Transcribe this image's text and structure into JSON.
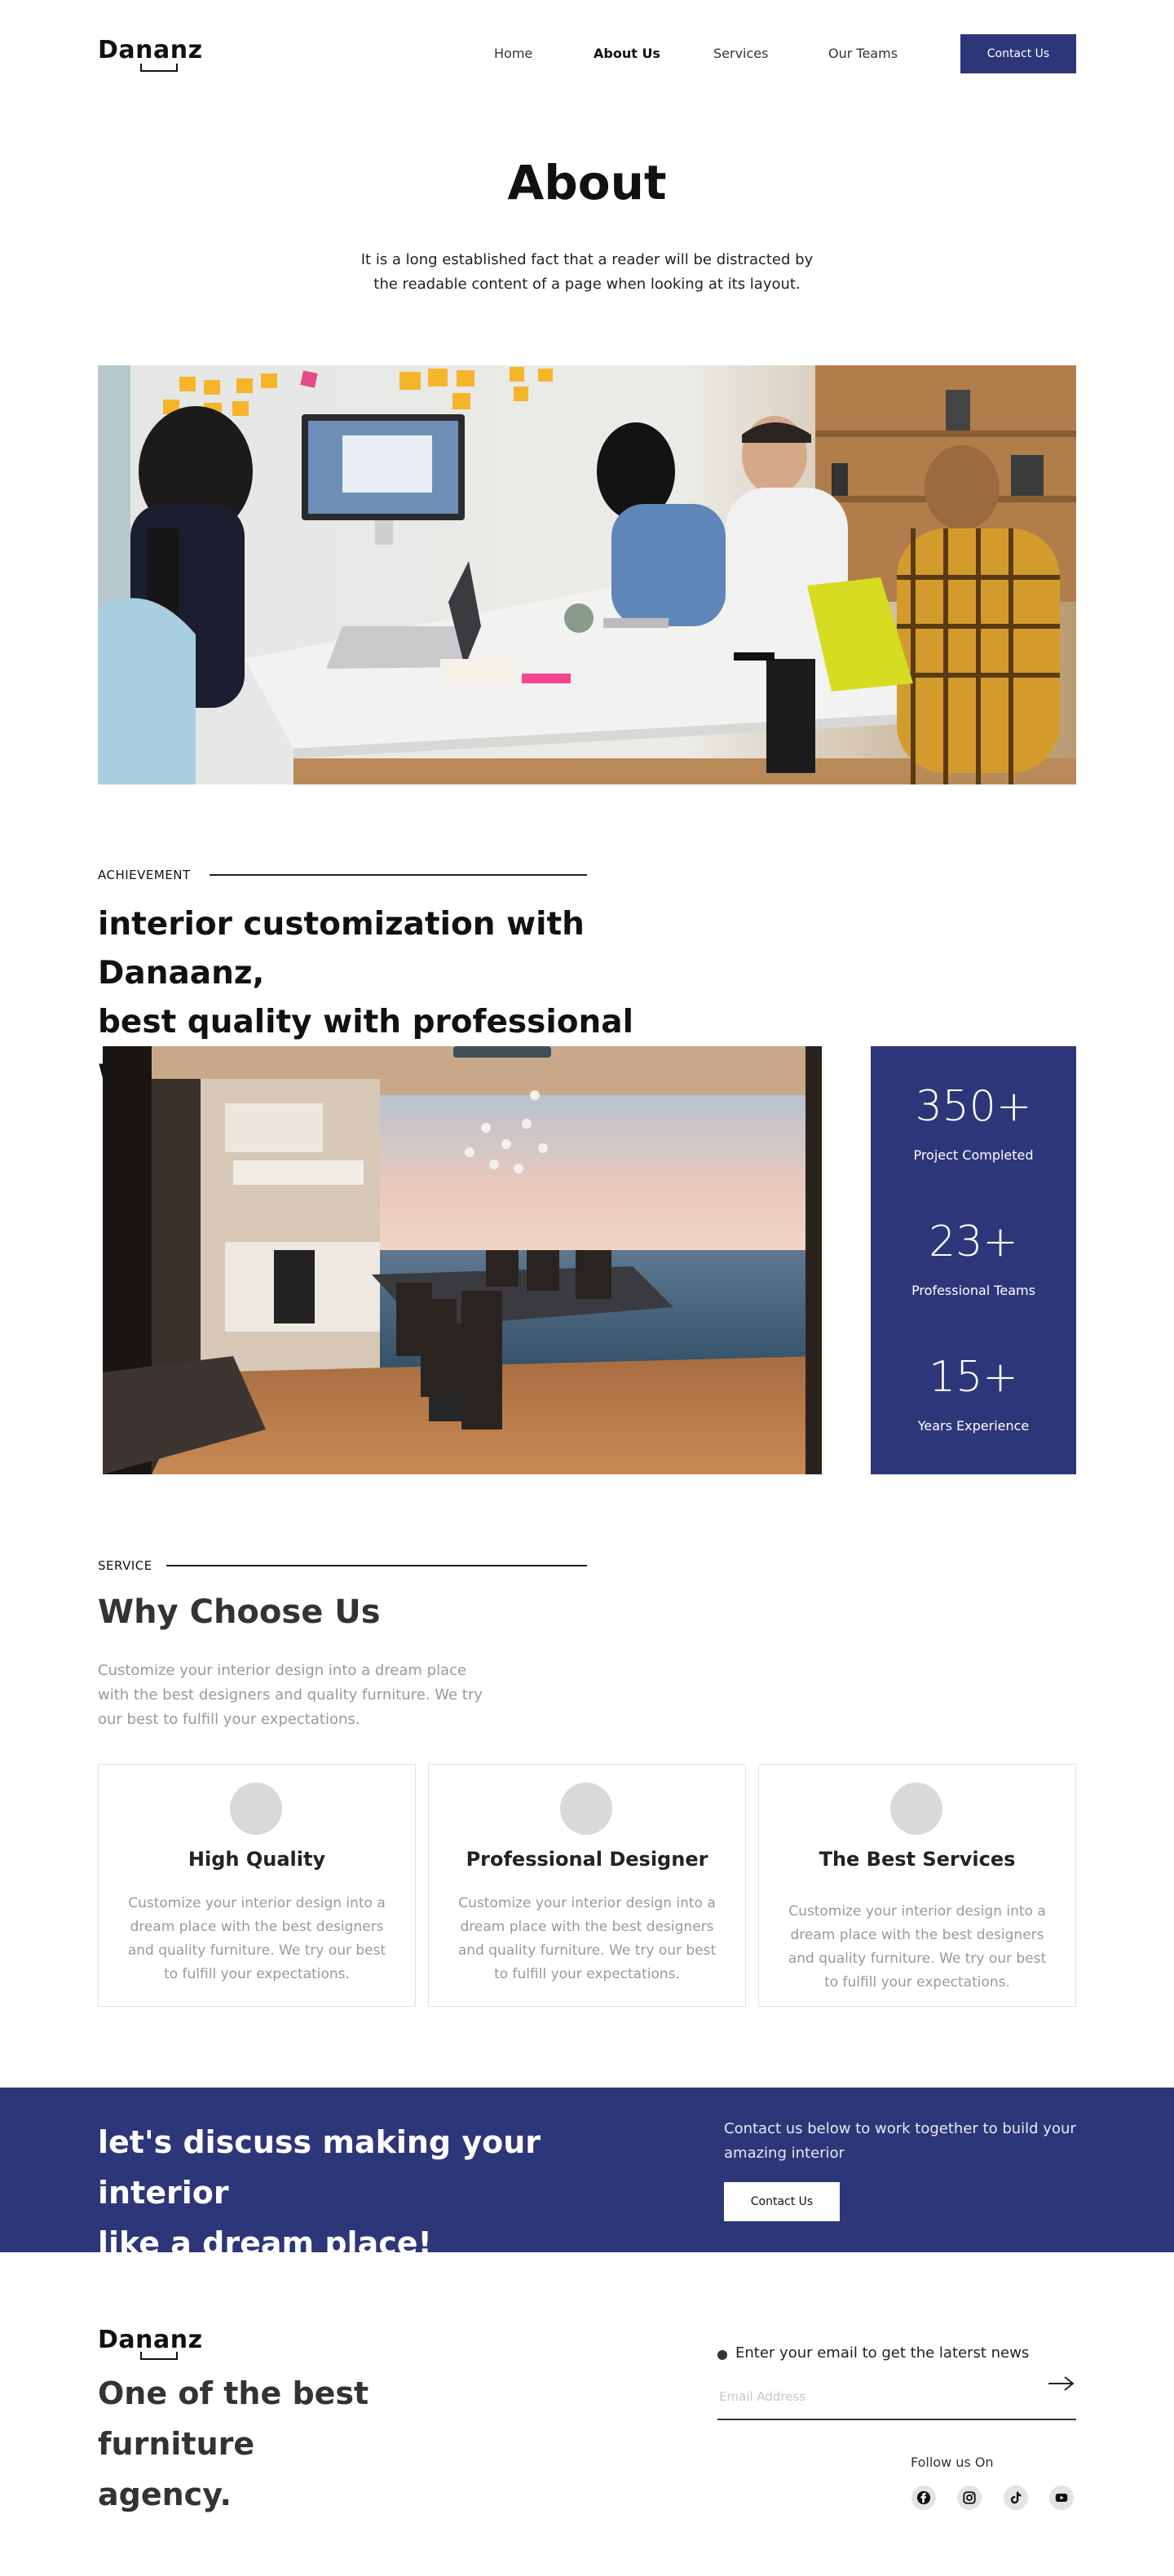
{
  "brand": {
    "logo": "Dananz"
  },
  "nav": {
    "items": [
      "Home",
      "About Us",
      "Services",
      "Our Teams"
    ],
    "contact_button": "Contact Us"
  },
  "about": {
    "title": "About",
    "subtitle": "It is a long established fact that a reader will be distracted by the readable content of a page when looking at its layout."
  },
  "achievement": {
    "label": "ACHIEVEMENT",
    "headline_line1": "interior customization with Danaanz,",
    "headline_line2": "best quality with professional workers"
  },
  "stats": [
    {
      "value": "350+",
      "label": "Project Completed"
    },
    {
      "value": "23+",
      "label": "Professional Teams"
    },
    {
      "value": "15+",
      "label": "Years Experience"
    }
  ],
  "service": {
    "label": "SERVICE",
    "title": "Why Choose Us",
    "text": "Customize your interior design into a dream place with the best designers and quality furniture. We try our best to fulfill your expectations.",
    "cards": [
      {
        "title": "High Quality",
        "text": "Customize your interior design into a dream place with the best designers and quality furniture. We try our best to fulfill your expectations."
      },
      {
        "title": "Professional Designer",
        "text": "Customize your interior design into a dream place with the best designers and quality furniture. We try our best to fulfill your expectations."
      },
      {
        "title": "The Best Services",
        "text": "Customize your interior design into a dream place with the best designers and quality furniture. We try our best to fulfill your expectations."
      }
    ]
  },
  "cta": {
    "title_line1": "let's discuss making your interior",
    "title_line2": "like a dream place!",
    "text": "Contact us below to work together to build your amazing interior",
    "button": "Contact Us"
  },
  "footer": {
    "logo": "Dananz",
    "tagline_line1": "One of the best furniture",
    "tagline_line2": "agency.",
    "newsletter_text": "Enter  your email to get the laterst news",
    "email_placeholder": "Email Address",
    "email_value": "",
    "follow_label": "Follow us On",
    "social_icons": [
      "facebook-icon",
      "instagram-icon",
      "tiktok-icon",
      "youtube-icon"
    ]
  },
  "colors": {
    "accent": "#2d3679",
    "text": "#111111",
    "muted": "#999999"
  }
}
